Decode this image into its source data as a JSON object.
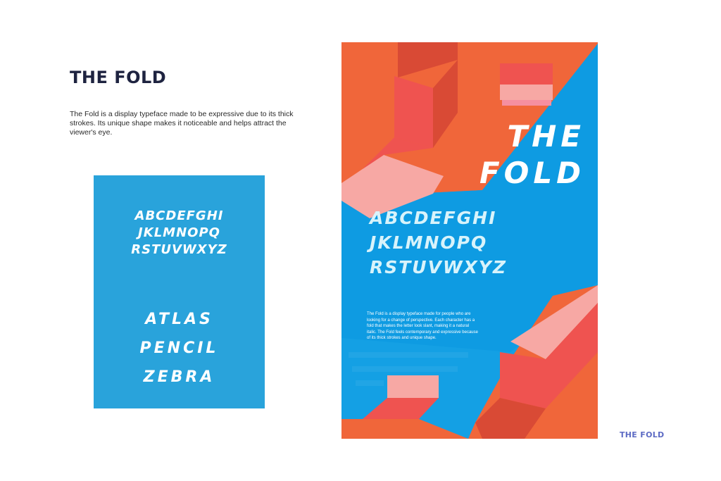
{
  "heading": "THE FOLD",
  "description": "The Fold is a display typeface made to be expressive due to its thick strokes. Its unique shape makes it noticeable and helps attract the viewer's eye.",
  "specimen_card": {
    "alphabet": [
      "ABCDEFGHI",
      "JKLMNOPQ",
      "RSTUVWXYZ"
    ],
    "words": [
      "ATLAS",
      "PENCIL",
      "ZEBRA"
    ]
  },
  "poster": {
    "title_lines": [
      "THE",
      "FOLD"
    ],
    "alphabet": [
      "ABCDEFGHI",
      "JKLMNOPQ",
      "RSTUVWXYZ"
    ],
    "body": "The Fold is a display typeface made for people who are looking for a change of perspective. Each character has a fold that makes the letter look slant, making it a natural italic. The Fold feels contemporary and expressive because of its thick strokes and unique shape."
  },
  "footer_brand": "THE FOLD",
  "colors": {
    "card_blue": "#29a3db",
    "poster_blue": "#14a0e4",
    "orange": "#f0663a",
    "coral": "#ef5350",
    "pink": "#f7a8a4",
    "dark_text": "#1e2340",
    "brand_purple": "#5d6bc4"
  }
}
